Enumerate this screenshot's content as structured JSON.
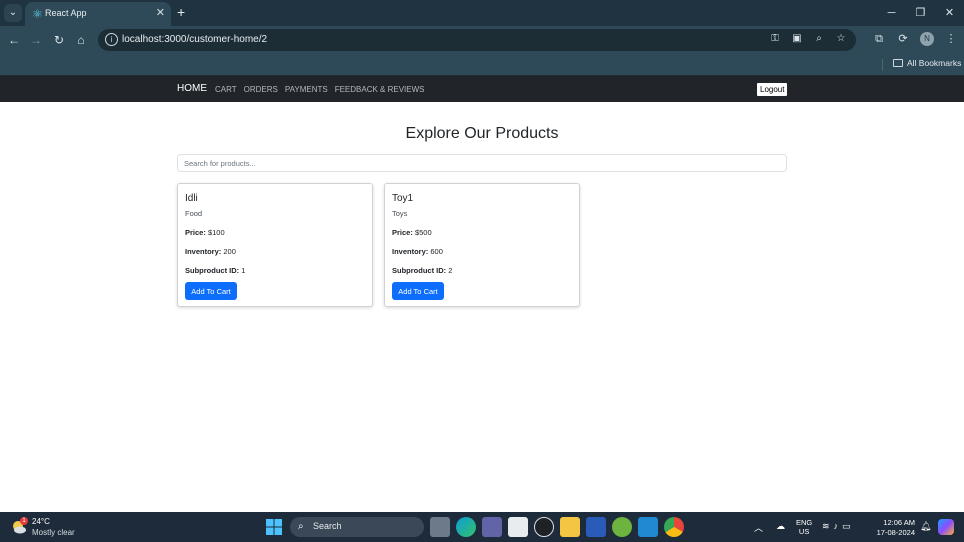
{
  "browser": {
    "tab_title": "React App",
    "url": "localhost:3000/customer-home/2",
    "bookmarks_label": "All Bookmarks",
    "profile_initial": "N"
  },
  "nav": {
    "home": "HOME",
    "links": [
      "CART",
      "ORDERS",
      "PAYMENTS",
      "FEEDBACK & REVIEWS"
    ],
    "logout": "Logout"
  },
  "page": {
    "title": "Explore Our Products",
    "search_placeholder": "Search for products..."
  },
  "labels": {
    "price": "Price:",
    "inventory": "Inventory:",
    "subproduct_id": "Subproduct ID:",
    "add_to_cart": "Add To Cart"
  },
  "products": [
    {
      "name": "Idli",
      "category": "Food",
      "price": "$100",
      "inventory": "200",
      "subproduct_id": "1"
    },
    {
      "name": "Toy1",
      "category": "Toys",
      "price": "$500",
      "inventory": "600",
      "subproduct_id": "2"
    }
  ],
  "taskbar": {
    "weather_temp": "24°C",
    "weather_desc": "Mostly clear",
    "weather_badge": "1",
    "search_label": "Search",
    "lang_line1": "ENG",
    "lang_line2": "US",
    "time": "12:06 AM",
    "date": "17-08-2024"
  },
  "colors": {
    "accent": "#0d6efd",
    "navbar": "#212529",
    "browser_chrome": "#2e4957"
  }
}
